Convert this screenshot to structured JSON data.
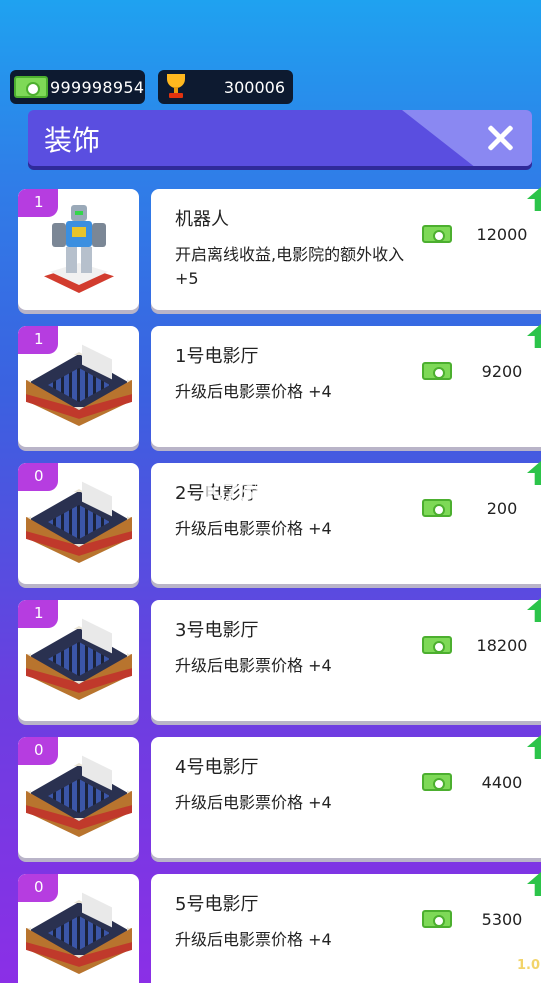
{
  "stats": {
    "money": "999998954",
    "trophies": "300006"
  },
  "header": {
    "title": "装饰"
  },
  "items": [
    {
      "level": "1",
      "name": "机器人",
      "desc": "开启离线收益,电影院的额外收入 +5",
      "price": "12000",
      "thumb": "robot"
    },
    {
      "level": "1",
      "name": "1号电影厅",
      "desc": "升级后电影票价格 +4",
      "price": "9200",
      "thumb": "hall"
    },
    {
      "level": "0",
      "name": "2号电影厅",
      "desc": "升级后电影票价格 +4",
      "price": "200",
      "thumb": "hall"
    },
    {
      "level": "1",
      "name": "3号电影厅",
      "desc": "升级后电影票价格 +4",
      "price": "18200",
      "thumb": "hall"
    },
    {
      "level": "0",
      "name": "4号电影厅",
      "desc": "升级后电影票价格 +4",
      "price": "4400",
      "thumb": "hall"
    },
    {
      "level": "0",
      "name": "5号电影厅",
      "desc": "升级后电影票价格 +4",
      "price": "5300",
      "thumb": "hall"
    }
  ],
  "watermark": {
    "logo": "K73",
    "text": "游戏之家",
    "sub": ".com"
  },
  "version": "1.0."
}
